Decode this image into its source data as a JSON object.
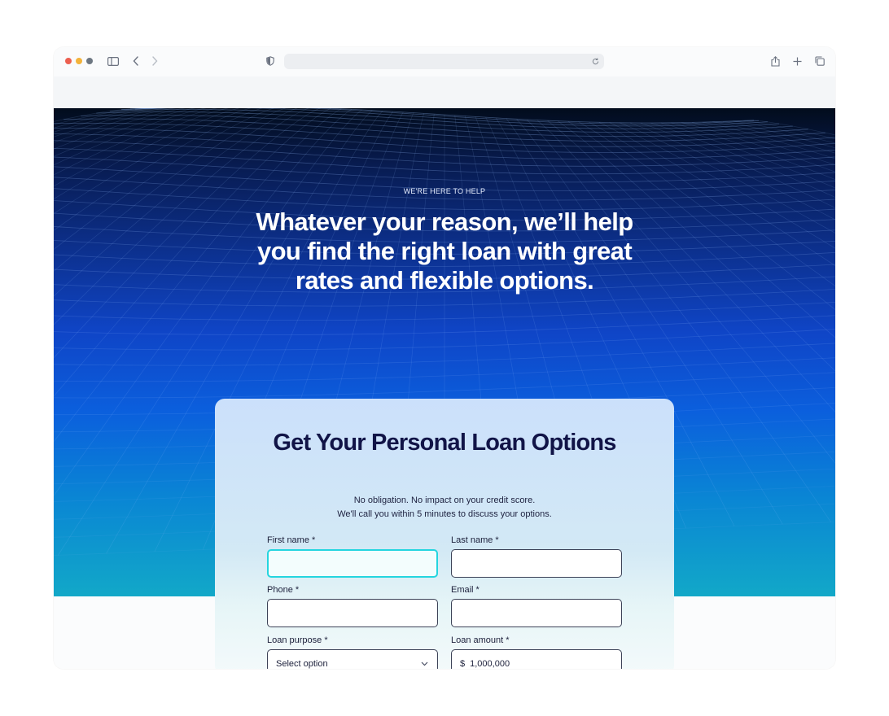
{
  "hero": {
    "eyebrow": "WE'RE HERE TO HELP",
    "headline": "Whatever your reason, we’ll help you find the right loan with great rates and flexible options."
  },
  "form": {
    "title": "Get Your Personal Loan Options",
    "subtitle_line1": "No obligation. No impact on your credit score.",
    "subtitle_line2": "We'll call you within 5 minutes to discuss your options.",
    "first_name_label": "First name *",
    "last_name_label": "Last name *",
    "phone_label": "Phone *",
    "email_label": "Email *",
    "loan_purpose_label": "Loan purpose *",
    "loan_purpose_value": "Select option",
    "loan_amount_label": "Loan amount *",
    "currency_symbol": "$",
    "loan_amount_value": "1,000,000"
  },
  "colors": {
    "accent_focus": "#25d5df",
    "title_navy": "#111447"
  }
}
